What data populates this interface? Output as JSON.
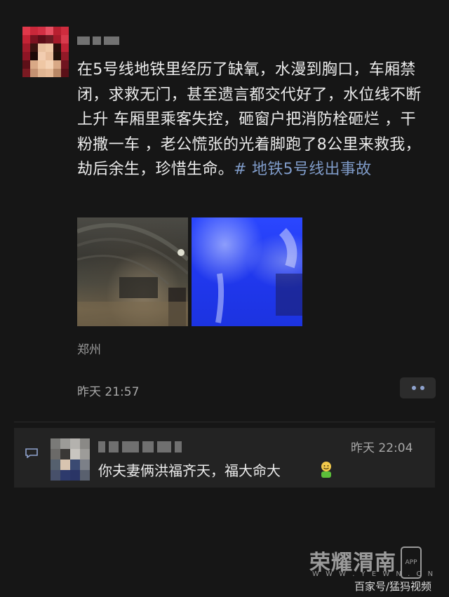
{
  "post": {
    "text": "在5号线地铁里经历了缺氧，水漫到胸口，车厢禁闭，求救无门，甚至遗言都交代好了，水位线不断上升 车厢里乘客失控，砸窗户把消防栓砸烂 ，干粉撒一车 ，老公慌张的光着脚跑了8公里来救我，劫后余生，珍惜生命。",
    "hashtag": "# 地铁5号线出事故",
    "location": "郑州",
    "timestamp": "昨天 21:57"
  },
  "comment": {
    "time": "昨天 22:04",
    "text": "你夫妻俩洪福齐天，福大命大"
  },
  "watermark": {
    "logo": "荣耀渭南",
    "domain": "W W W . Y E W N . C N",
    "app_badge": "APP",
    "source": "百家号/猛犸视频"
  },
  "colors": {
    "background": "#161616",
    "link": "#7f9bc8",
    "comment_bg": "#232323"
  },
  "icons": [
    "comment-bubble-icon",
    "more-dots-icon",
    "smile-emoji-icon"
  ]
}
